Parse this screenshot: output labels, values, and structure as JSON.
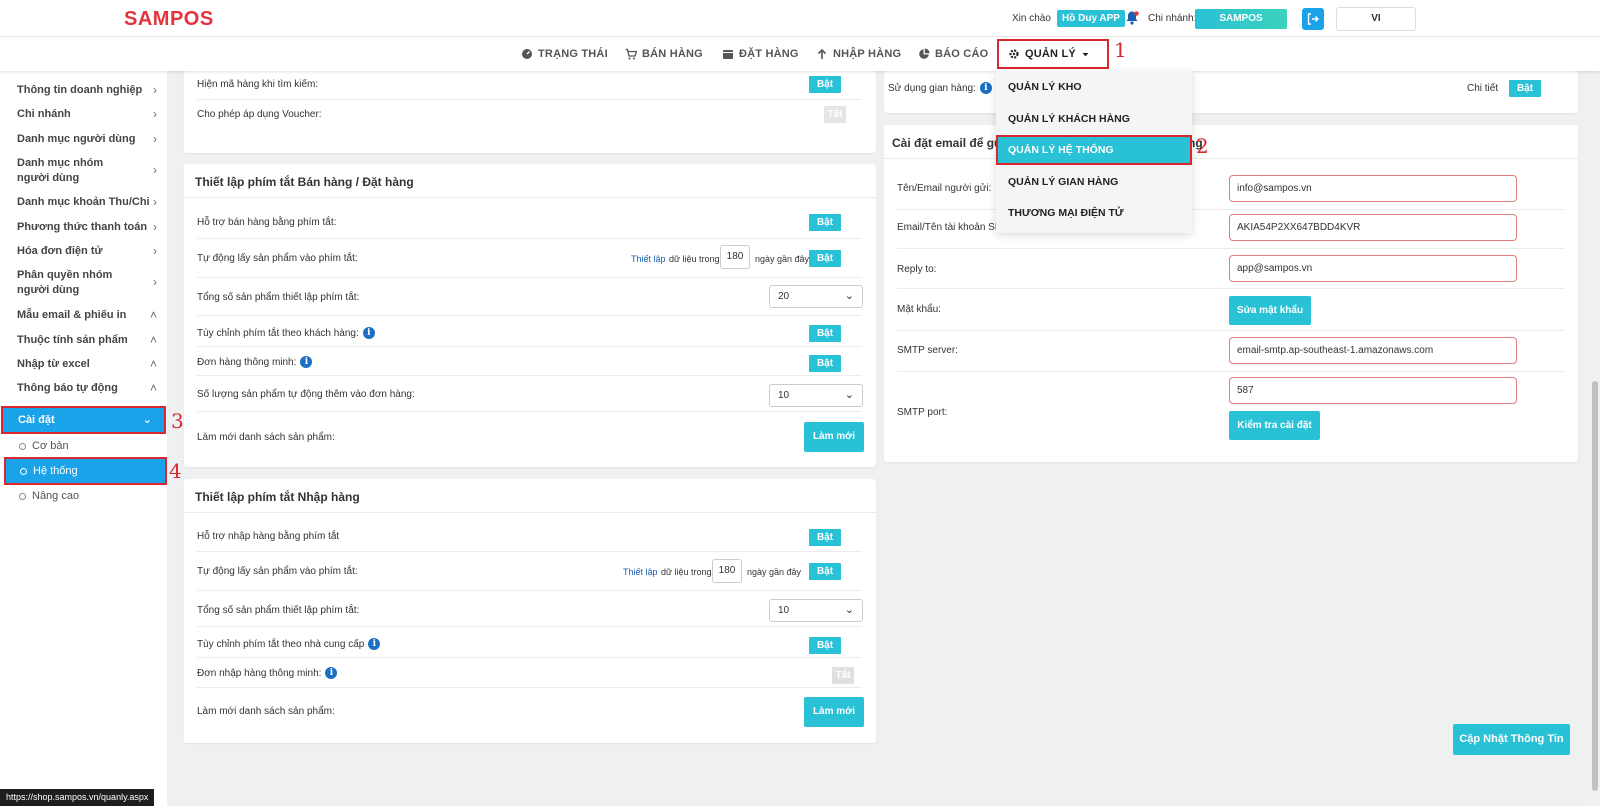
{
  "header": {
    "logo": "SAMPOS",
    "greeting": "Xin chào",
    "user": "Hồ Duy APP",
    "branch_label": "Chi nhánh:",
    "branch": "SAMPOS",
    "language": "VI"
  },
  "nav": {
    "items": [
      "TRẠNG THÁI",
      "BÁN HÀNG",
      "ĐẶT HÀNG",
      "NHẬP HÀNG",
      "BÁO CÁO",
      "QUẢN LÝ"
    ]
  },
  "dropdown": {
    "items": [
      "QUẢN LÝ KHO",
      "QUẢN LÝ KHÁCH HÀNG",
      "QUẢN LÝ HỆ THỐNG",
      "QUẢN LÝ GIAN HÀNG",
      "THƯƠNG MẠI ĐIỆN TỬ"
    ]
  },
  "markers": [
    "1",
    "2",
    "3",
    "4"
  ],
  "sidebar": {
    "items": [
      "Thông tin doanh nghiệp",
      "Chi nhánh",
      "Danh mục người dùng",
      "Danh mục nhóm người dùng",
      "Danh mục khoản Thu/Chi",
      "Phương thức thanh toán",
      "Hóa đơn điện tử",
      "Phân quyền nhóm người dùng",
      "Mẫu email & phiếu in",
      "Thuộc tính sản phẩm",
      "Nhập từ excel",
      "Thông báo tự động"
    ],
    "active": "Cài đặt",
    "sub_items": [
      "Cơ bản",
      "Hệ thống",
      "Nâng cao"
    ]
  },
  "top_panel": {
    "rows": [
      "Hiện mã hàng khi tìm kiếm:",
      "Cho phép áp dụng Voucher:"
    ],
    "toggles": [
      "Bật",
      "Tắt"
    ]
  },
  "sale_shortcut": {
    "title": "Thiết lập phím tắt Bán hàng / Đặt hàng",
    "rows": [
      "Hỗ trợ bán hàng bằng phím tắt:",
      "Tự động lấy sản phẩm vào phím tắt:",
      "Tổng số sản phẩm thiết lập phím tắt:",
      "Tùy chỉnh phím tắt theo khách hàng:",
      "Đơn hàng thông minh:",
      "Số lượng sản phẩm tự động thêm vào đơn hàng:",
      "Làm mới danh sách sản phẩm:"
    ],
    "setup_link": "Thiết lập",
    "data_in": "dữ liệu trong",
    "days": "180",
    "recent": "ngày gần đây",
    "total_select": "20",
    "qty_select": "10",
    "on": "Bật",
    "refresh": "Làm mới"
  },
  "import_shortcut": {
    "title": "Thiết lập phím tắt Nhập hàng",
    "rows": [
      "Hỗ trợ nhập hàng bằng phím tắt",
      "Tự động lấy sản phẩm vào phím tắt:",
      "Tổng số sản phẩm thiết lập phím tắt:",
      "Tùy chỉnh phím tắt theo nhà cung cấp",
      "Đơn nhập hàng thông minh:",
      "Làm mới danh sách sản phẩm:"
    ],
    "setup_link": "Thiết lập",
    "data_in": "dữ liệu trong",
    "days": "180",
    "recent": "ngày gần đây",
    "total_select": "10",
    "on": "Bật",
    "off": "Tắt",
    "refresh": "Làm mới"
  },
  "right_top": {
    "row": "Sử dụng gian hàng:",
    "detail": "Chi tiết",
    "toggle": "Bật"
  },
  "email": {
    "title_start": "Cài đặt email để gử",
    "title_end": "ng",
    "sender_label": "Tên/Email người gửi:",
    "sender": "info@sampos.vn",
    "account_label": "Email/Tên tài khoản SM",
    "account": "AKIA54P2XX647BDD4KVR",
    "reply_label": "Reply to:",
    "reply": "app@sampos.vn",
    "password_label": "Mật khẩu:",
    "password_btn": "Sửa mật khẩu",
    "smtp_server_label": "SMTP server:",
    "smtp_server": "email-smtp.ap-southeast-1.amazonaws.com",
    "smtp_port_label": "SMTP port:",
    "smtp_port": "587",
    "check_btn": "Kiểm tra cài đặt"
  },
  "update_btn": "Cập Nhật Thông Tin",
  "status_url": "https://shop.sampos.vn/quanly.aspx"
}
